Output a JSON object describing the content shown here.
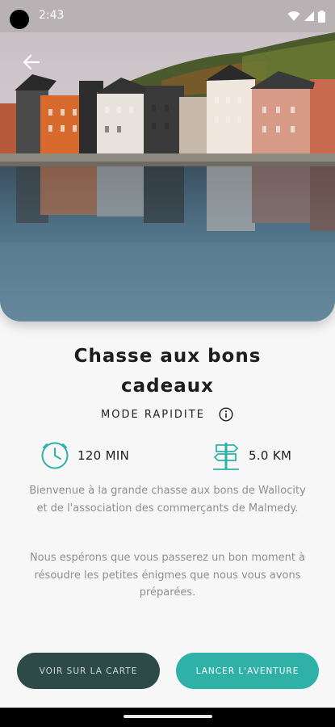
{
  "status_bar": {
    "time": "2:43"
  },
  "hero": {
    "image_description_icon": "town-photo"
  },
  "header": {
    "back_icon": "arrow-left-icon"
  },
  "hunt": {
    "title": "Chasse aux bons cadeaux",
    "mode": "MODE RAPIDITE",
    "duration": "120 MIN",
    "distance": "5.0 KM",
    "description_1": "Bienvenue à la grande chasse aux bons de Wallocity et de l'association des commerçants de Malmedy.",
    "description_2": "Nous espérons que vous passerez un bon moment à résoudre les petites énigmes que nous vous avons préparées."
  },
  "actions": {
    "map_label": "VOIR SUR LA CARTE",
    "start_label": "LANCER L'AVENTURE"
  },
  "colors": {
    "accent": "#2fb1a8",
    "dark_button": "#2e4a48",
    "status_bar": "#b9b2b4"
  }
}
